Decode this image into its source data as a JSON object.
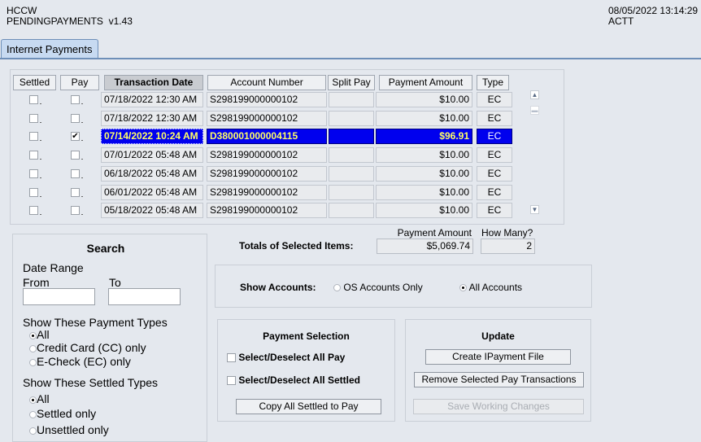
{
  "header": {
    "app_code": "HCCW",
    "module": "PENDINGPAYMENTS  v1.43",
    "datetime": "08/05/2022 13:14:29",
    "user": "ACTT"
  },
  "tab": {
    "label": "Internet Payments"
  },
  "table": {
    "columns": [
      "Settled",
      "Pay",
      "Transaction Date",
      "Account Number",
      "Split Pay",
      "Payment Amount",
      "Type"
    ],
    "rows": [
      {
        "settled": false,
        "pay": false,
        "date": "07/18/2022 12:30 AM",
        "account": "S298199000000102",
        "split": "",
        "amount": "$10.00",
        "type": "EC",
        "selected": false
      },
      {
        "settled": false,
        "pay": false,
        "date": "07/18/2022 12:30 AM",
        "account": "S298199000000102",
        "split": "",
        "amount": "$10.00",
        "type": "EC",
        "selected": false
      },
      {
        "settled": false,
        "pay": true,
        "date": "07/14/2022 10:24 AM",
        "account": "D380001000004115",
        "split": "",
        "amount": "$96.91",
        "type": "EC",
        "selected": true
      },
      {
        "settled": false,
        "pay": false,
        "date": "07/01/2022 05:48 AM",
        "account": "S298199000000102",
        "split": "",
        "amount": "$10.00",
        "type": "EC",
        "selected": false
      },
      {
        "settled": false,
        "pay": false,
        "date": "06/18/2022 05:48 AM",
        "account": "S298199000000102",
        "split": "",
        "amount": "$10.00",
        "type": "EC",
        "selected": false
      },
      {
        "settled": false,
        "pay": false,
        "date": "06/01/2022 05:48 AM",
        "account": "S298199000000102",
        "split": "",
        "amount": "$10.00",
        "type": "EC",
        "selected": false
      },
      {
        "settled": false,
        "pay": false,
        "date": "05/18/2022 05:48 AM",
        "account": "S298199000000102",
        "split": "",
        "amount": "$10.00",
        "type": "EC",
        "selected": false
      }
    ],
    "check_mark": "✔"
  },
  "search": {
    "title": "Search",
    "date_range_label": "Date Range",
    "from_label": "From",
    "to_label": "To",
    "from_value": "",
    "to_value": "",
    "payment_types_label": "Show These Payment Types",
    "payment_types": [
      "All",
      "Credit Card (CC) only",
      "E-Check (EC) only"
    ],
    "payment_type_selected": 0,
    "settled_types_label": "Show These Settled Types",
    "settled_types": [
      "All",
      "Settled only",
      "Unsettled only"
    ],
    "settled_type_selected": 0
  },
  "totals": {
    "label": "Totals of Selected Items:",
    "amount_header": "Payment Amount",
    "count_header": "How Many?",
    "amount": "$5,069.74",
    "count": "2"
  },
  "accounts": {
    "label": "Show Accounts:",
    "options": [
      "OS Accounts Only",
      "All Accounts"
    ],
    "selected": 1
  },
  "payment_selection": {
    "title": "Payment Selection",
    "select_all_pay": "Select/Deselect All Pay",
    "select_all_settled": "Select/Deselect All Settled",
    "copy_button": "Copy All Settled to Pay"
  },
  "update": {
    "title": "Update",
    "create_button": "Create IPayment File",
    "remove_button": "Remove Selected Pay Transactions",
    "save_button": "Save Working Changes"
  }
}
